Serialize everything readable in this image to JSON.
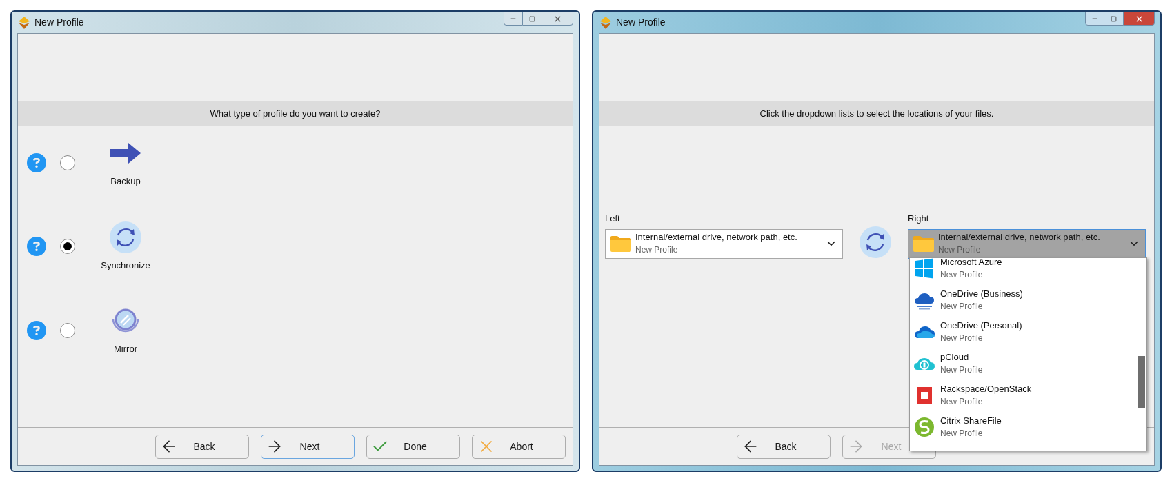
{
  "windows": [
    {
      "title": "New Profile",
      "active": false,
      "kind": "profile_type",
      "heading": "What type of profile do you want to create?",
      "options": [
        {
          "label": "Backup",
          "kind": "backup",
          "selected": false
        },
        {
          "label": "Synchronize",
          "kind": "sync",
          "selected": true
        },
        {
          "label": "Mirror",
          "kind": "mirror",
          "selected": false
        }
      ],
      "buttons": [
        {
          "label": "Back",
          "kind": "back",
          "focused": false,
          "disabled": false
        },
        {
          "label": "Next",
          "kind": "next",
          "focused": true,
          "disabled": false
        },
        {
          "label": "Done",
          "kind": "done",
          "focused": false,
          "disabled": false
        },
        {
          "label": "Abort",
          "kind": "abort",
          "focused": false,
          "disabled": false
        }
      ]
    },
    {
      "title": "New Profile",
      "active": true,
      "kind": "locations",
      "heading": "Click the dropdown lists to select the locations of your files.",
      "left": {
        "label": "Left",
        "value": "Internal/external drive, network path, etc.",
        "subtitle": "New Profile",
        "open": false
      },
      "right": {
        "label": "Right",
        "value": "Internal/external drive, network path, etc.",
        "subtitle": "New Profile",
        "open": true
      },
      "dropdown_items": [
        {
          "name": "Microsoft Azure",
          "subtitle": "New Profile",
          "kind": "azure"
        },
        {
          "name": "OneDrive (Business)",
          "subtitle": "New Profile",
          "kind": "onedrive_business"
        },
        {
          "name": "OneDrive (Personal)",
          "subtitle": "New Profile",
          "kind": "onedrive"
        },
        {
          "name": "pCloud",
          "subtitle": "New Profile",
          "kind": "pcloud"
        },
        {
          "name": "Rackspace/OpenStack",
          "subtitle": "New Profile",
          "kind": "rackspace"
        },
        {
          "name": "Citrix ShareFile",
          "subtitle": "New Profile",
          "kind": "citrix"
        }
      ],
      "buttons": [
        {
          "label": "Back",
          "kind": "back",
          "focused": false,
          "disabled": false
        },
        {
          "label": "Next",
          "kind": "next",
          "focused": false,
          "disabled": true
        }
      ]
    }
  ]
}
